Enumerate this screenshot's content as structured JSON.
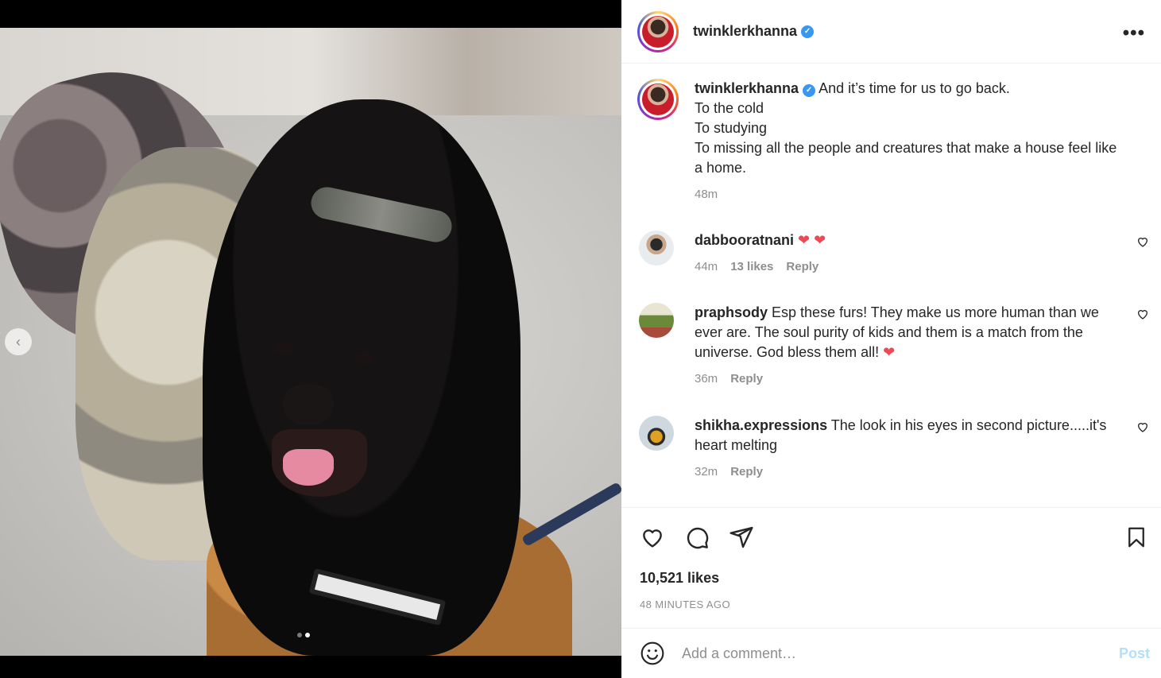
{
  "post": {
    "author": "twinklerkhanna",
    "verified_mark": "✓",
    "more_label": "•••",
    "media": {
      "prev_arrow": "‹",
      "slide_count": 2,
      "current_slide": 2
    }
  },
  "caption": {
    "username": "twinklerkhanna",
    "lines": [
      "And it’s time for us to go back.",
      "To the cold",
      "To studying",
      "To missing all the people and creatures that make a house feel like a home."
    ],
    "time": "48m"
  },
  "comments": [
    {
      "username": "dabbooratnani",
      "text": "",
      "emoji": "❤ ❤",
      "time": "44m",
      "likes": "13 likes",
      "reply": "Reply"
    },
    {
      "username": "praphsody",
      "text": "Esp these furs! They make us more human than we ever are. The soul purity of kids and them is a match from the universe. God bless them all! ",
      "emoji": "❤",
      "time": "36m",
      "likes": "",
      "reply": "Reply"
    },
    {
      "username": "shikha.expressions",
      "text": "The look in his eyes in second picture.....it's heart melting",
      "emoji": "",
      "time": "32m",
      "likes": "",
      "reply": "Reply"
    }
  ],
  "engagement": {
    "likes": "10,521 likes",
    "posted": "48 MINUTES AGO"
  },
  "composer": {
    "placeholder": "Add a comment…",
    "post_label": "Post"
  },
  "colors": {
    "verified": "#3897f0",
    "heart": "#ed4956",
    "post_disabled": "#b2dffc",
    "muted": "#8e8e8e"
  },
  "icons": [
    "heart-icon",
    "comment-icon",
    "share-icon",
    "bookmark-icon",
    "emoji-icon",
    "more-icon",
    "chevron-left-icon",
    "verified-icon"
  ]
}
